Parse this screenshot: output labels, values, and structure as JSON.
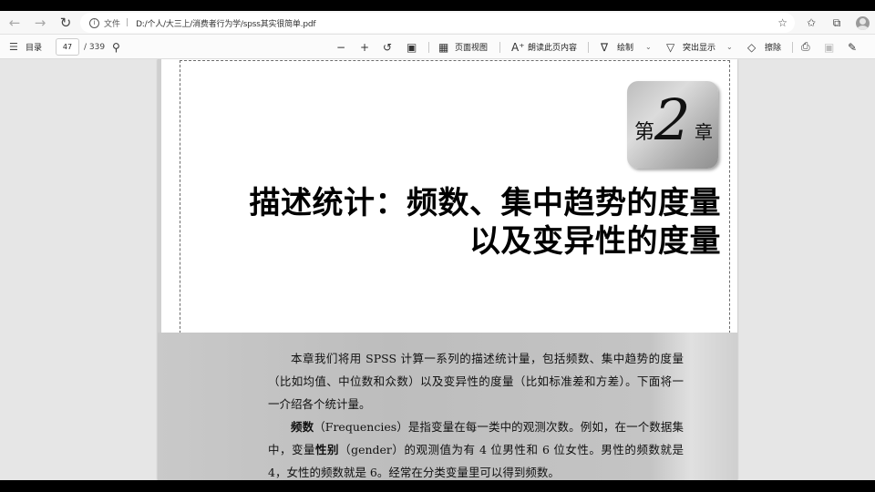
{
  "address_bar": {
    "back_icon": "arrow-left-icon",
    "forward_icon": "arrow-right-icon",
    "refresh_icon": "refresh-icon",
    "file_label": "文件",
    "separator": "|",
    "url": "D:/个人/大三上/消费者行为学/spss其实很简单.pdf"
  },
  "pdf_toolbar": {
    "toc_label": "目录",
    "page_current": "47",
    "page_total": "/ 339",
    "page_view_label": "页面视图",
    "read_aloud_label": "朗读此页内容",
    "draw_label": "绘制",
    "highlight_label": "突出显示",
    "erase_label": "擦除"
  },
  "document": {
    "chapter_prefix": "第",
    "chapter_number": "2",
    "chapter_suffix": "章",
    "title_line1": "描述统计：频数、集中趋势的度量",
    "title_line2": "以及变异性的度量",
    "paragraph1": "本章我们将用 SPSS 计算一系列的描述统计量，包括频数、集中趋势的度量（比如均值、中位数和众数）以及变异性的度量（比如标准差和方差）。下面将一一介绍各个统计量。",
    "p2_term": "频数",
    "p2_term_en": "（Frequencies）",
    "p2_text_a": "是指变量在每一类中的观测次数。例如，在一个数据集中，变量",
    "p2_var": "性别",
    "p2_var_en": "（gender）",
    "p2_text_b": "的观测值为有 4 位男性和 6 位女性。男性的频数就是 4，女性的频数就是 6。经常在分类变量里可以得到频数。"
  },
  "colors": {
    "app_background": "#e6e6e6",
    "page_background": "#ffffff",
    "text": "#111111"
  }
}
